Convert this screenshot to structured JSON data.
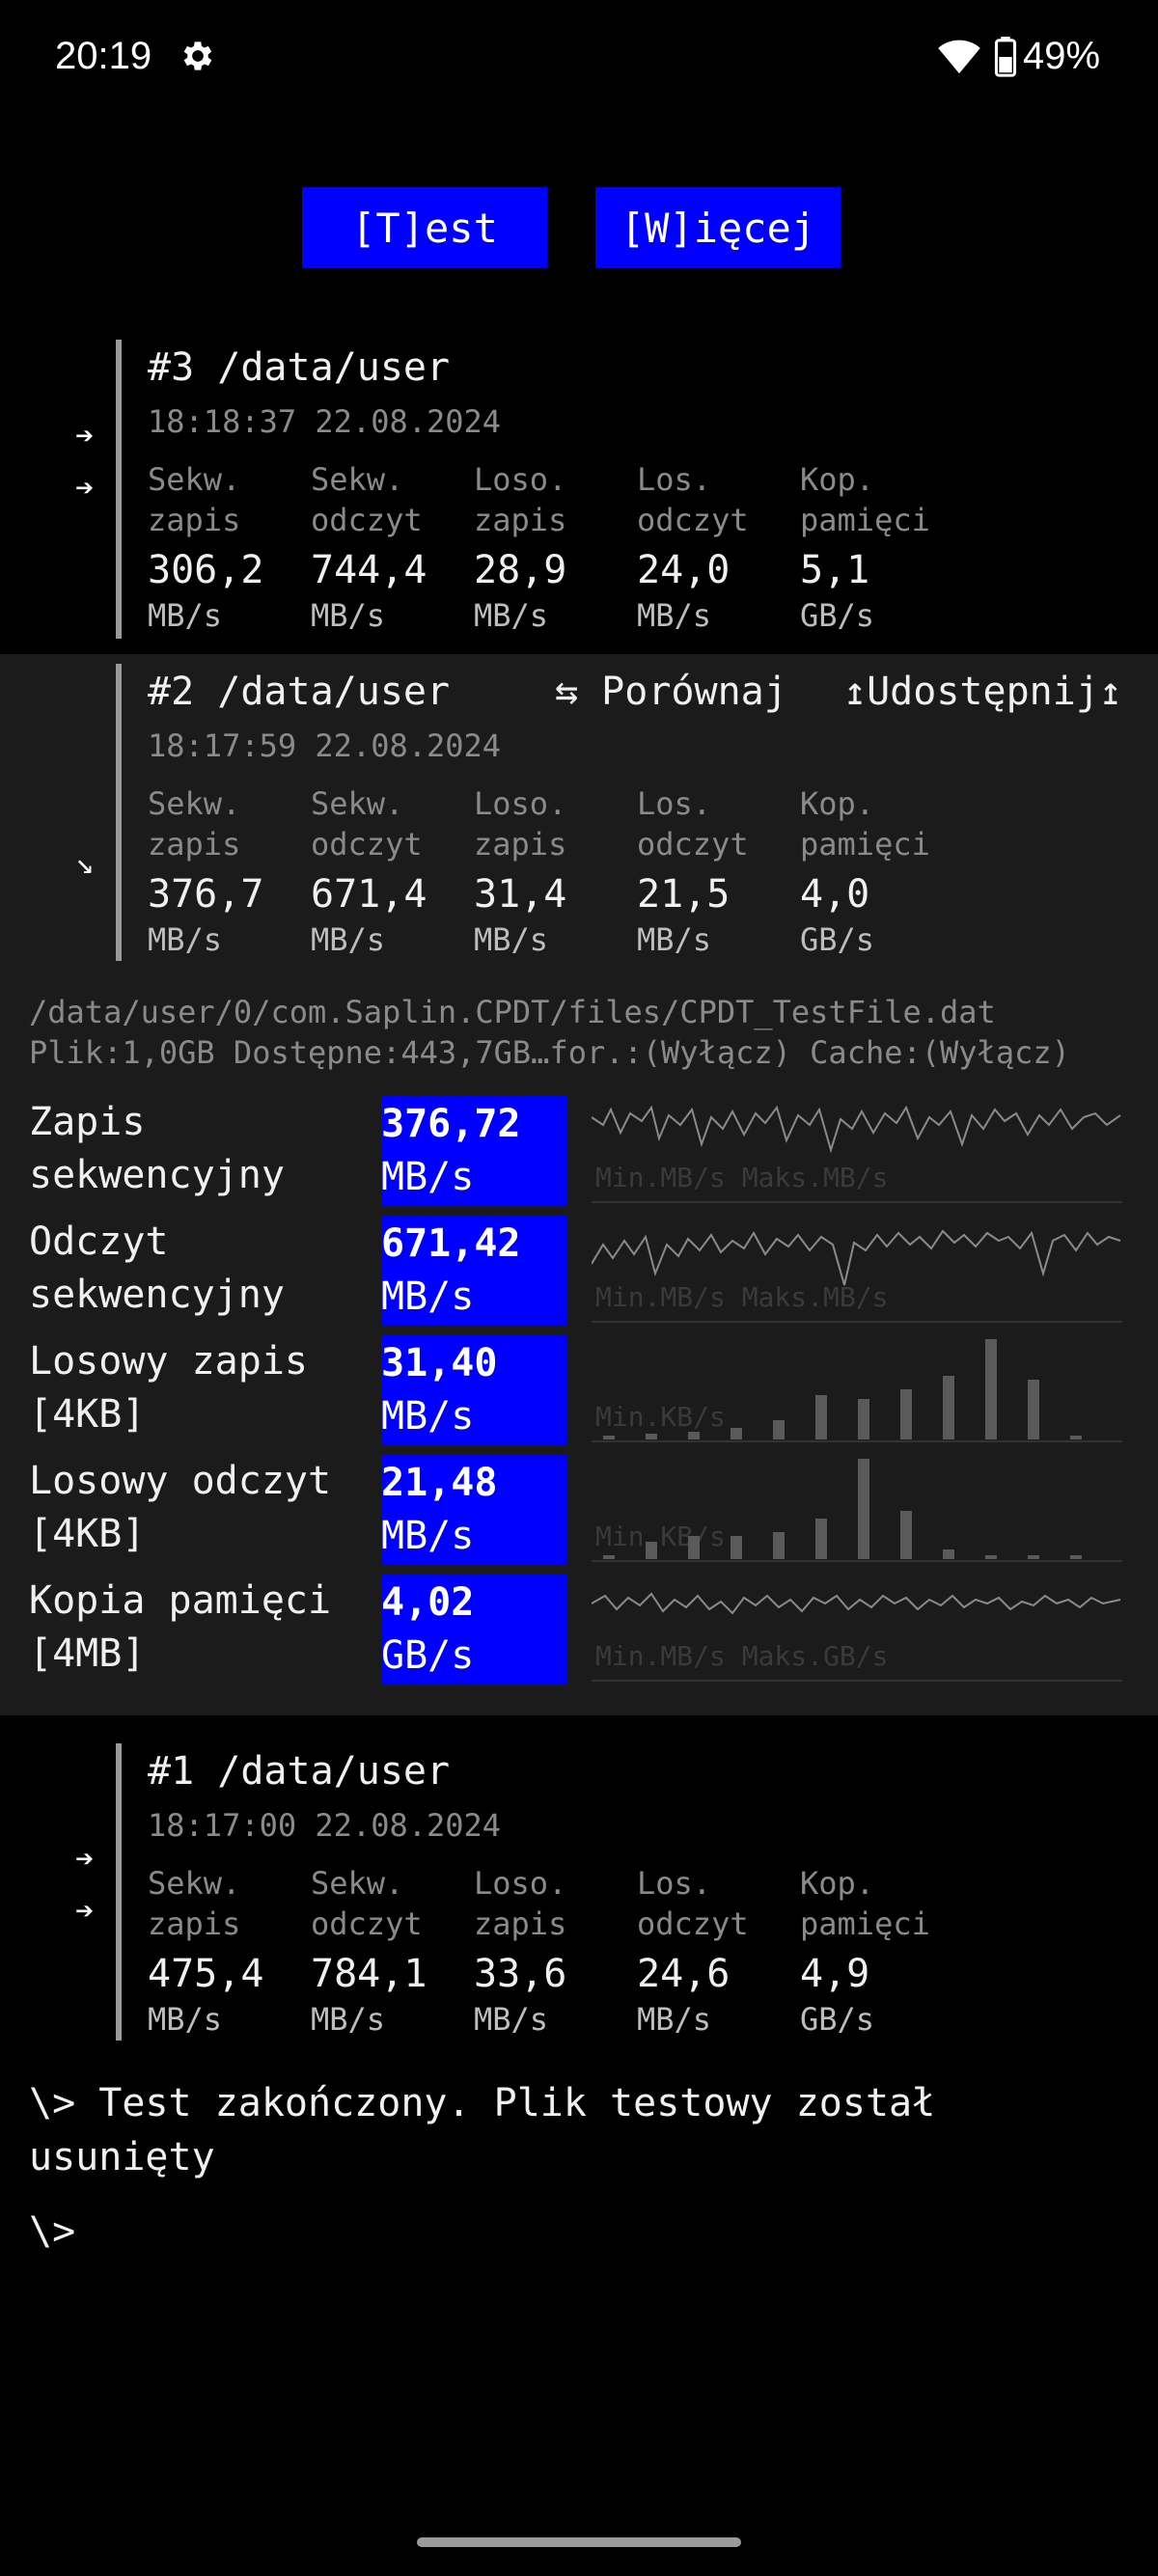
{
  "status_bar": {
    "time": "20:19",
    "battery": "49%"
  },
  "buttons": {
    "test": "[T]est",
    "more": "[W]ięcej"
  },
  "column_labels": [
    "Sekw.\nzapis",
    "Sekw.\nodczyt",
    "Loso.\nzapis",
    "Los.\nodczyt",
    "Kop.\npamięci"
  ],
  "runs": [
    {
      "title": "#3 /data/user",
      "date": "18:18:37 22.08.2024",
      "values": [
        "306,2",
        "744,4",
        "28,9",
        "24,0",
        "5,1"
      ],
      "units": [
        "MB/s",
        "MB/s",
        "MB/s",
        "MB/s",
        "GB/s"
      ]
    },
    {
      "title": "#2 /data/user",
      "date": "18:17:59 22.08.2024",
      "values": [
        "376,7",
        "671,4",
        "31,4",
        "21,5",
        "4,0"
      ],
      "units": [
        "MB/s",
        "MB/s",
        "MB/s",
        "MB/s",
        "GB/s"
      ],
      "compare": "⇆ Porównaj",
      "share": "↥Udostępnij↥"
    },
    {
      "title": "#1 /data/user",
      "date": "18:17:00 22.08.2024",
      "values": [
        "475,4",
        "784,1",
        "33,6",
        "24,6",
        "4,9"
      ],
      "units": [
        "MB/s",
        "MB/s",
        "MB/s",
        "MB/s",
        "GB/s"
      ]
    }
  ],
  "details": {
    "path": "/data/user/0/com.Saplin.CPDT/files/CPDT_TestFile.dat",
    "info": "Plik:1,0GB Dostępne:443,7GB…for.:(Wyłącz) Cache:(Wyłącz)",
    "metrics": [
      {
        "name": "Zapis\nsekwencyjny",
        "value": "376,72",
        "unit": "MB/s",
        "ghost": "Min.MB/s Maks.MB/s"
      },
      {
        "name": "Odczyt\nsekwencyjny",
        "value": "671,42",
        "unit": "MB/s",
        "ghost": "Min.MB/s Maks.MB/s"
      },
      {
        "name": "Losowy zapis\n[4KB]",
        "value": "31,40",
        "unit": "MB/s",
        "ghost": "Min.KB/s"
      },
      {
        "name": "Losowy odczyt\n[4KB]",
        "value": "21,48",
        "unit": "MB/s",
        "ghost": "Min.KB/s"
      },
      {
        "name": "Kopia pamięci\n[4MB]",
        "value": "4,02",
        "unit": "GB/s",
        "ghost": "Min.MB/s Maks.GB/s"
      }
    ]
  },
  "console": {
    "line1": "\\> Test zakończony. Plik testowy został\nusunięty",
    "prompt": "\\>"
  }
}
